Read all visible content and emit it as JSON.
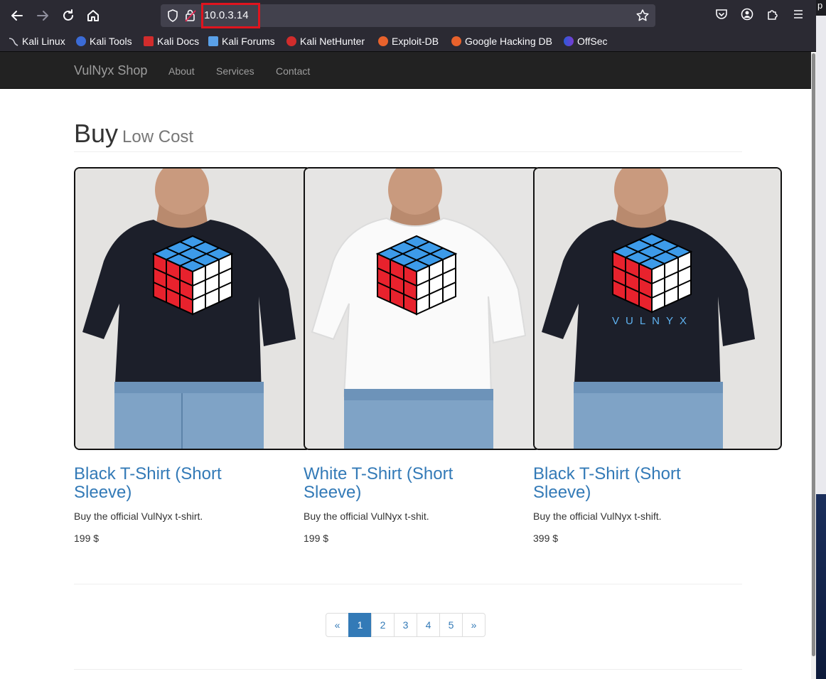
{
  "browser": {
    "url": "10.0.3.14",
    "bookmarks": [
      "Kali Linux",
      "Kali Tools",
      "Kali Docs",
      "Kali Forums",
      "Kali NetHunter",
      "Exploit-DB",
      "Google Hacking DB",
      "OffSec"
    ]
  },
  "site": {
    "brand": "VulNyx Shop",
    "nav": [
      "About",
      "Services",
      "Contact"
    ]
  },
  "main": {
    "title": "Buy",
    "subtitle": "Low Cost",
    "products": [
      {
        "title": "Black T-Shirt (Short Sleeve)",
        "desc": "Buy the official VulNyx t-shirt.",
        "price": "199 $"
      },
      {
        "title": "White T-Shirt (Short Sleeve)",
        "desc": "Buy the official VulNyx t-shit.",
        "price": "199 $"
      },
      {
        "title": "Black T-Shirt (Short Sleeve)",
        "desc": "Buy the official VulNyx t-shift.",
        "price": "399 $"
      }
    ],
    "print_text": "VULNYX"
  },
  "pagination": {
    "prev": "«",
    "pages": [
      "1",
      "2",
      "3",
      "4",
      "5"
    ],
    "next": "»",
    "active": "1"
  },
  "edge": {
    "char": "p"
  }
}
